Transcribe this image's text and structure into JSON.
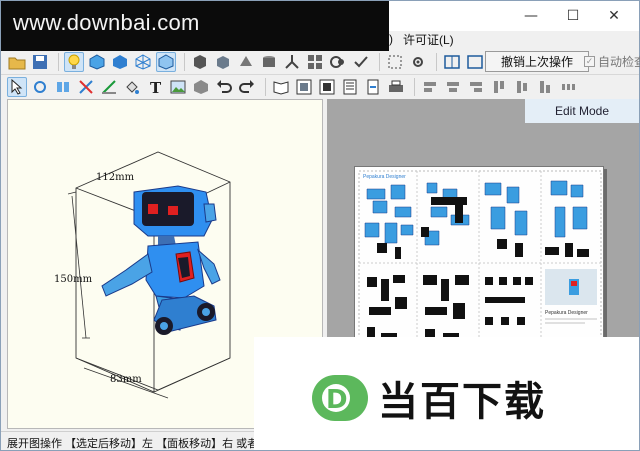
{
  "watermark": {
    "text": "www.downbai.com"
  },
  "window": {
    "minimize": "—",
    "maximize": "☐",
    "close": "✕"
  },
  "menu": {
    "partial": ")",
    "license": "许可证(L)"
  },
  "toolbar": {
    "undo_label": "撤销上次操作",
    "auto_check_label": "自动检查"
  },
  "pane2d": {
    "mode_label": "Edit Mode",
    "sheet_title": "Pepakura Designer",
    "sheet_caption": "Pepakura Designer"
  },
  "pane3d": {
    "dim_width": "112mm",
    "dim_height": "150mm",
    "dim_depth": "83mm"
  },
  "statusbar": {
    "text": "展开图操作 【选定后移动】左 【面板移动】右 或者"
  },
  "brand": {
    "logo_letter": "D",
    "name": "当百下载",
    "accent": "#5cb85c"
  },
  "colors": {
    "robot_blue": "#2f8ff0",
    "robot_dark": "#1a3a8a",
    "eye_red": "#e02020",
    "part_blue": "#3b9de0"
  }
}
